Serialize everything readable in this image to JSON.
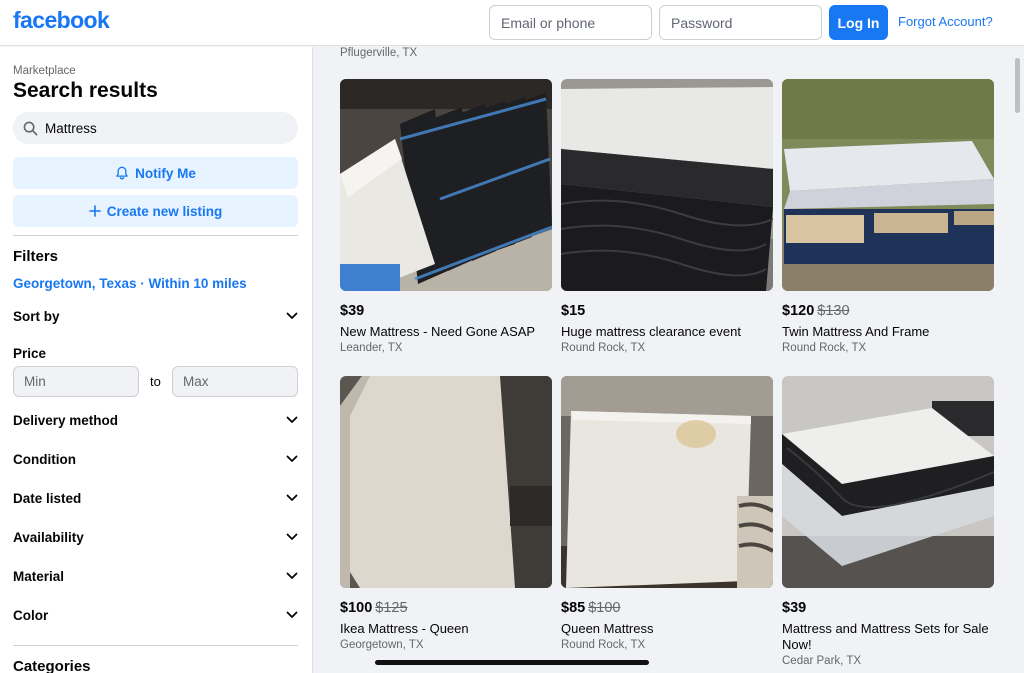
{
  "header": {
    "logo": "facebook",
    "email_placeholder": "Email or phone",
    "password_placeholder": "Password",
    "login_label": "Log In",
    "forgot_label": "Forgot Account?"
  },
  "sidebar": {
    "crumb": "Marketplace",
    "title": "Search results",
    "search_value": "Mattress",
    "notify_label": "Notify Me",
    "create_label": "Create new listing",
    "filters_title": "Filters",
    "location": "Georgetown, Texas · Within 10 miles",
    "sort_label": "Sort by",
    "price_label": "Price",
    "min_placeholder": "Min",
    "to_label": "to",
    "max_placeholder": "Max",
    "filters": [
      "Delivery method",
      "Condition",
      "Date listed",
      "Availability",
      "Material",
      "Color"
    ],
    "categories_title": "Categories"
  },
  "main": {
    "prev_location": "Pflugerville, TX",
    "listings": [
      {
        "price": "$39",
        "old_price": "",
        "title": "New Mattress - Need Gone ASAP",
        "location": "Leander, TX"
      },
      {
        "price": "$15",
        "old_price": "",
        "title": "Huge mattress clearance event",
        "location": "Round Rock, TX"
      },
      {
        "price": "$120",
        "old_price": "$130",
        "title": "Twin Mattress And Frame",
        "location": "Round Rock, TX"
      },
      {
        "price": "$100",
        "old_price": "$125",
        "title": "Ikea Mattress - Queen",
        "location": "Georgetown, TX"
      },
      {
        "price": "$85",
        "old_price": "$100",
        "title": "Queen Mattress",
        "location": "Round Rock, TX"
      },
      {
        "price": "$39",
        "old_price": "",
        "title": "Mattress and Mattress Sets for Sale Now!",
        "location": "Cedar Park, TX"
      }
    ]
  },
  "colors": {
    "brand": "#1877f2",
    "page_bg": "#f0f2f5",
    "secondary_text": "#65676b"
  },
  "icons": {
    "search": "search-icon",
    "bell": "bell-icon",
    "plus": "plus-icon",
    "chevron": "chevron-down-icon"
  }
}
